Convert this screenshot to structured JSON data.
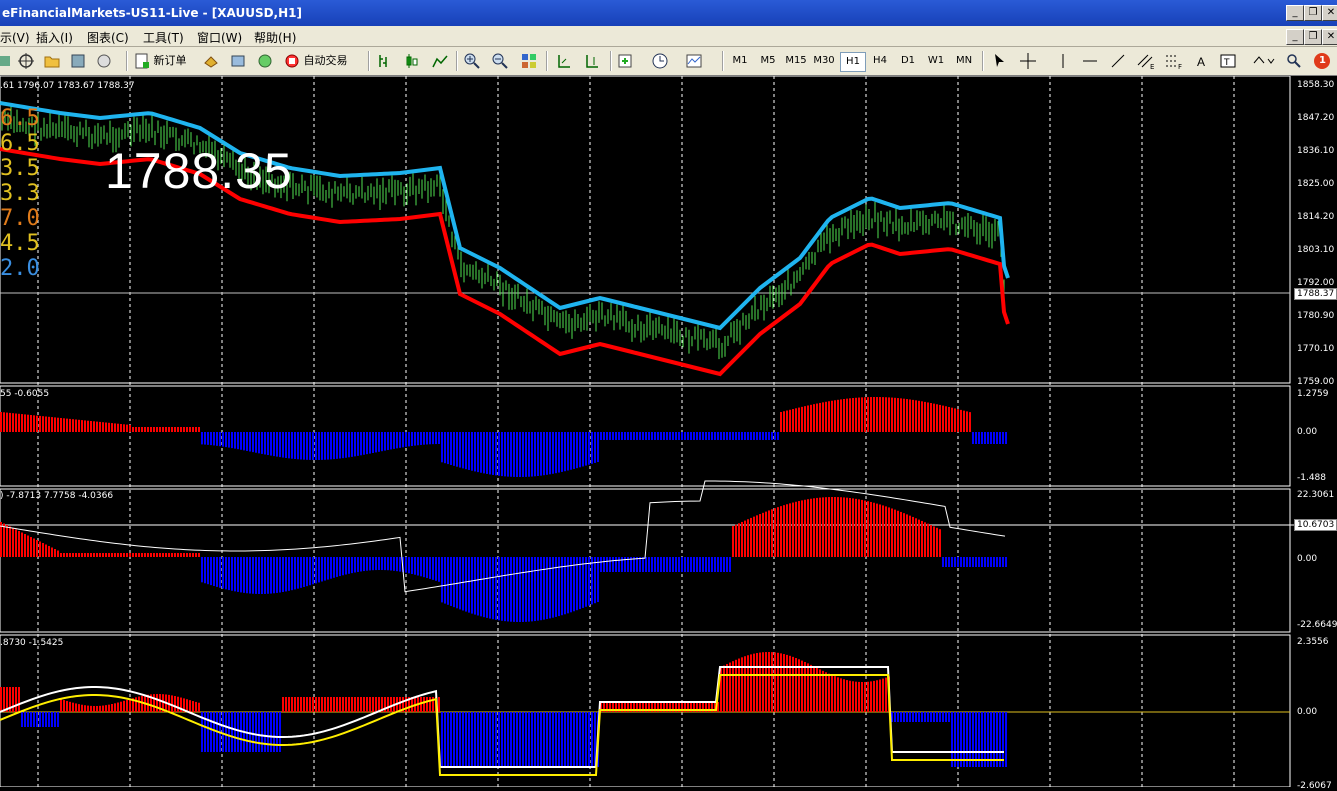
{
  "window": {
    "title": "eFinancialMarkets-US11-Live - [XAUUSD,H1]",
    "controls": [
      "_",
      "❐",
      "✕"
    ]
  },
  "menu": {
    "items": [
      "示(V)",
      "插入(I)",
      "图表(C)",
      "工具(T)",
      "窗口(W)",
      "帮助(H)"
    ]
  },
  "toolbar": {
    "new_order_label": "新订单",
    "auto_trade_label": "自动交易",
    "timeframes": [
      "M1",
      "M5",
      "M15",
      "M30",
      "H1",
      "H4",
      "D1",
      "W1",
      "MN"
    ],
    "active_timeframe": "H1",
    "notification_count": "1"
  },
  "main_chart": {
    "ohlc_label": ".61 1796.07 1783.67 1788.37",
    "big_price": "1788.35",
    "legend_values": [
      {
        "text": "6.5",
        "color": "#e07b1a"
      },
      {
        "text": "6.5",
        "color": "#e0c020"
      },
      {
        "text": "3.5",
        "color": "#e0c020"
      },
      {
        "text": "3.3",
        "color": "#e0c020"
      },
      {
        "text": "7.0",
        "color": "#e07b1a"
      },
      {
        "text": "4.5",
        "color": "#e0c020"
      },
      {
        "text": "2.0",
        "color": "#3a8ee0"
      }
    ],
    "price_axis": [
      "1858.30",
      "1847.20",
      "1836.10",
      "1825.00",
      "1814.20",
      "1803.10",
      "1792.00",
      "1780.90",
      "1770.10",
      "1759.00"
    ],
    "current_price": "1788.37"
  },
  "indicator1": {
    "label": "55 -0.6055",
    "axis": [
      "1.2759",
      "0.00",
      "-1.488"
    ]
  },
  "indicator2": {
    "label": ") -7.8713 7.7758 -4.0366",
    "axis": [
      "22.3061",
      "10.6703",
      "0.00",
      "-22.6649"
    ],
    "highlight_value": "10.6703"
  },
  "indicator3": {
    "label": ".8730 -1.5425",
    "axis": [
      "2.3556",
      "0.00",
      "-2.6067"
    ]
  },
  "colors": {
    "bull": "#ff0000",
    "bear": "#0000ff",
    "candle": "#4fe04f",
    "band_upper": "#1fb4ef",
    "band_lower": "#ff0000",
    "grid": "#ffffff"
  }
}
